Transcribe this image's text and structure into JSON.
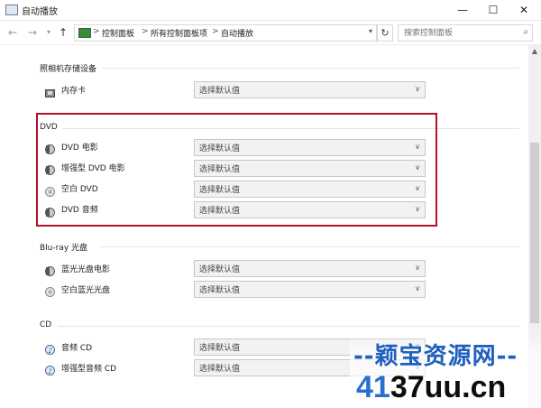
{
  "window": {
    "title": "自动播放",
    "controls": {
      "minimize": "—",
      "maximize": "☐",
      "close": "✕"
    }
  },
  "address_bar": {
    "breadcrumbs": [
      "控制面板",
      "所有控制面板项",
      "自动播放"
    ],
    "separator": ">",
    "search_placeholder": "搜索控制面板"
  },
  "sections": [
    {
      "title": "照相机存储设备",
      "items": [
        {
          "label": "内存卡",
          "icon": "memory-card-icon",
          "value": "选择默认值"
        }
      ]
    },
    {
      "title": "DVD",
      "items": [
        {
          "label": "DVD 电影",
          "icon": "dvd-movie-icon",
          "value": "选择默认值"
        },
        {
          "label": "增强型 DVD 电影",
          "icon": "enhanced-dvd-icon",
          "value": "选择默认值"
        },
        {
          "label": "空白 DVD",
          "icon": "blank-disc-icon",
          "value": "选择默认值"
        },
        {
          "label": "DVD 音频",
          "icon": "dvd-audio-icon",
          "value": "选择默认值"
        }
      ]
    },
    {
      "title": "Blu-ray 光盘",
      "items": [
        {
          "label": "蓝光光盘电影",
          "icon": "bluray-movie-icon",
          "value": "选择默认值"
        },
        {
          "label": "空白蓝光光盘",
          "icon": "blank-bluray-icon",
          "value": "选择默认值"
        }
      ]
    },
    {
      "title": "CD",
      "items": [
        {
          "label": "音频 CD",
          "icon": "audio-cd-icon",
          "value": "选择默认值"
        },
        {
          "label": "增强型音频 CD",
          "icon": "enhanced-audio-cd-icon",
          "value": "选择默认值"
        }
      ]
    }
  ],
  "watermark": {
    "title": "--颖宝资源网--",
    "url_prefix": "41",
    "url": "37uu.cn"
  },
  "colors": {
    "highlight_border": "#b3102a",
    "watermark_blue": "#1e5fbf"
  }
}
